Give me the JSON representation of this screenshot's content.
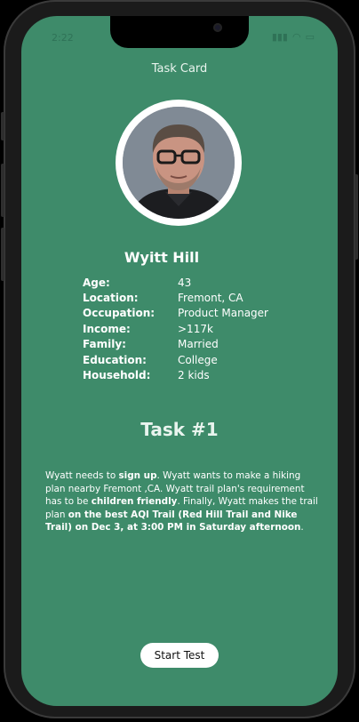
{
  "status_bar": {
    "time": "2:22",
    "icons": [
      "signal-icon",
      "wifi-icon",
      "battery-icon"
    ]
  },
  "header": {
    "title": "Task Card"
  },
  "persona": {
    "name": "Wyitt Hill",
    "fields": [
      {
        "label": "Age:",
        "value": "43"
      },
      {
        "label": "Location:",
        "value": "Fremont, CA"
      },
      {
        "label": "Occupation:",
        "value": "Product Manager"
      },
      {
        "label": "Income:",
        "value": ">117k"
      },
      {
        "label": "Family:",
        "value": "Married"
      },
      {
        "label": "Education:",
        "value": "College"
      },
      {
        "label": "Household:",
        "value": "2 kids"
      }
    ]
  },
  "task": {
    "title": "Task #1",
    "text_segments": [
      {
        "text": "Wyatt needs to ",
        "bold": false
      },
      {
        "text": "sign up",
        "bold": true
      },
      {
        "text": ". Wyatt wants to make a hiking plan nearby Fremont ,CA. Wyatt trail plan's requirement has to be ",
        "bold": false
      },
      {
        "text": "children friendly",
        "bold": true
      },
      {
        "text": ". Finally, Wyatt makes the trail plan ",
        "bold": false
      },
      {
        "text": "on the best AQI Trail (Red Hill Trail and Nike Trail) on Dec 3, at 3:00 PM in Saturday afternoon",
        "bold": true
      },
      {
        "text": ".",
        "bold": false
      }
    ]
  },
  "actions": {
    "start_label": "Start Test"
  },
  "colors": {
    "screen_bg": "#3e8b6a",
    "text": "#ffffff",
    "button_bg": "#ffffff"
  }
}
